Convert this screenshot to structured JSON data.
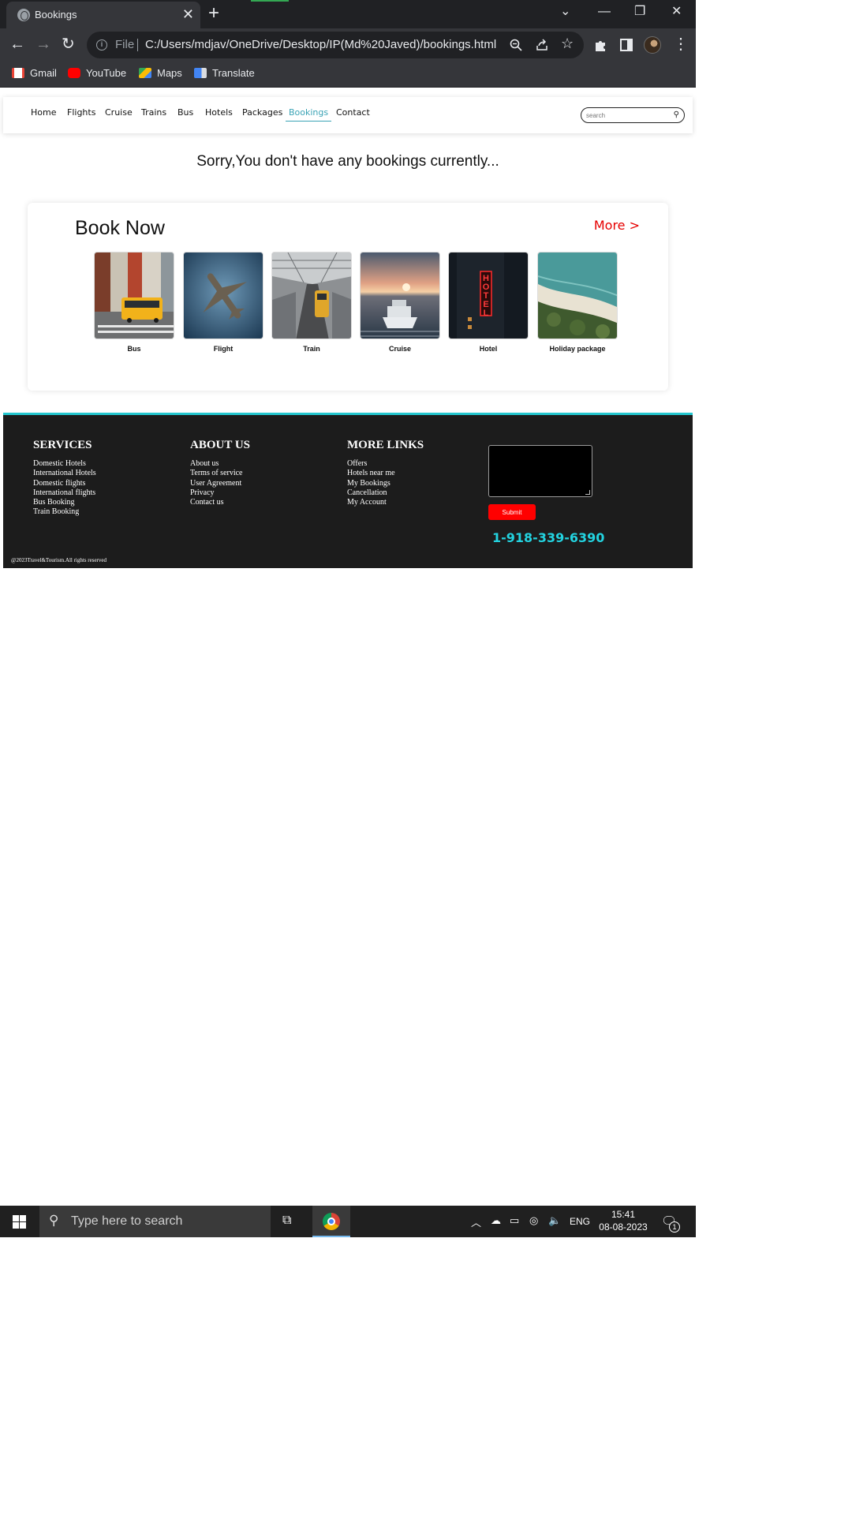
{
  "browser": {
    "tab_title": "Bookings",
    "tab_close": "✕",
    "new_tab": "+",
    "scheme_label": "File",
    "url": "C:/Users/mdjav/OneDrive/Desktop/IP(Md%20Javed)/bookings.html",
    "bookmarks": [
      {
        "label": "Gmail",
        "icon": "gmail-icon",
        "color": "#ea4335"
      },
      {
        "label": "YouTube",
        "icon": "youtube-icon",
        "color": "#ff0000"
      },
      {
        "label": "Maps",
        "icon": "maps-icon",
        "color": "#34a853"
      },
      {
        "label": "Translate",
        "icon": "translate-icon",
        "color": "#4285f4"
      }
    ]
  },
  "nav": {
    "links": [
      "Home",
      "Flights",
      "Cruise",
      "Trains",
      "Bus",
      "Hotels",
      "Packages",
      "Bookings",
      "Contact"
    ],
    "active": "Bookings",
    "search_placeholder": "search"
  },
  "message": "Sorry,You don't have any bookings currently...",
  "book_now": {
    "title": "Book Now",
    "more": "More >",
    "items": [
      "Bus",
      "Flight",
      "Train",
      "Cruise",
      "Hotel",
      "Holiday package"
    ],
    "hotel_sign": "HOTEL"
  },
  "footer": {
    "services": {
      "title": "SERVICES",
      "links": [
        "Domestic Hotels",
        "International Hotels",
        "Domestic flights",
        "International flights",
        "Bus Booking",
        "Train Booking"
      ]
    },
    "about": {
      "title": "ABOUT US",
      "links": [
        "About us",
        "Terms of service",
        "User Agreement",
        "Privacy",
        "Contact us"
      ]
    },
    "more": {
      "title": "MORE LINKS",
      "links": [
        "Offers",
        "Hotels near me",
        "My Bookings",
        "Cancellation",
        "My Account"
      ]
    },
    "submit": "Submit",
    "phone": "1-918-339-6390",
    "copyright": "@2023Travel&Tourism.All rights reserved"
  },
  "colors": {
    "accent": "#3aa3b5",
    "more_link": "#e60000",
    "submit": "#ff0000",
    "phone": "#23d3e0",
    "footer_bg": "#1c1c1c"
  },
  "taskbar": {
    "search_placeholder": "Type here to search",
    "language": "ENG",
    "time": "15:41",
    "date": "08-08-2023",
    "notifications": "1"
  }
}
